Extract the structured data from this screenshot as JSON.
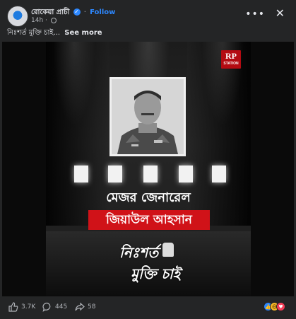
{
  "post": {
    "author": "রোকেয়া প্রাচী",
    "follow_label": "Follow",
    "timestamp": "14h",
    "privacy_icon": "globe-icon",
    "caption": "নিঃশর্ত মুক্তি চাই...",
    "see_more_label": "See more"
  },
  "toolbar": {
    "more_icon": "more-icon",
    "close_icon": "close-icon"
  },
  "poster": {
    "logo_main": "RP",
    "logo_sub": "STATION",
    "title": "মেজর জেনারেল",
    "name": "জিয়াউল আহসান",
    "slogan_line1": "নিঃশর্ত",
    "slogan_line2": "মুক্তি চাই",
    "accent_color": "#d01218"
  },
  "engagement": {
    "likes": "3.7K",
    "comments": "445",
    "shares": "58",
    "reaction_icons": [
      "like-reaction-icon",
      "haha-reaction-icon",
      "love-reaction-icon"
    ]
  }
}
